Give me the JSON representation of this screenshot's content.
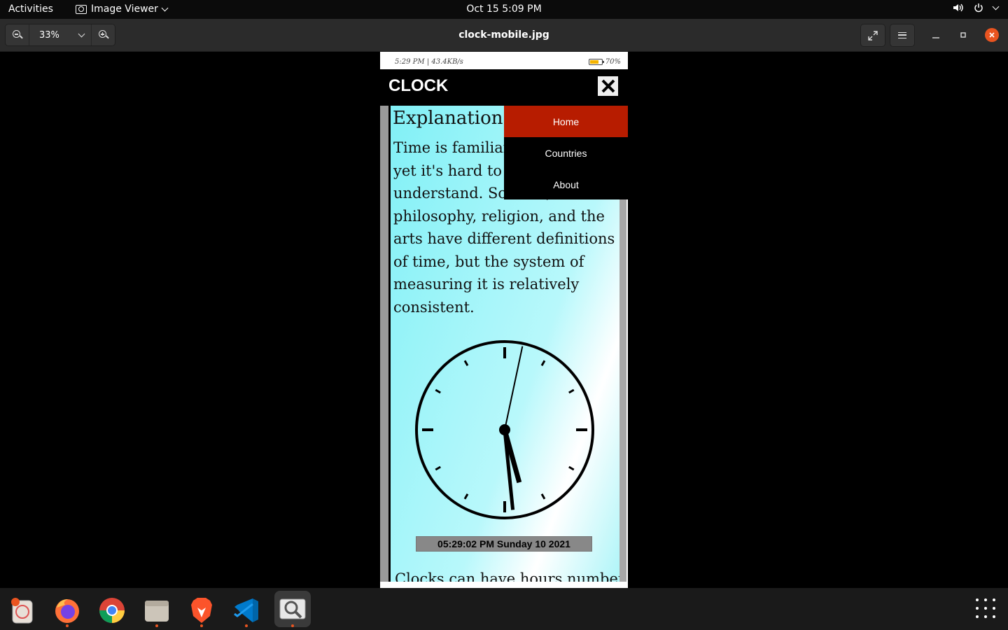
{
  "topbar": {
    "activities": "Activities",
    "app_name": "Image Viewer",
    "datetime": "Oct 15  5:09 PM"
  },
  "headerbar": {
    "zoom_level": "33%",
    "file_title": "clock-mobile.jpg"
  },
  "phone": {
    "status_left": "5:29 PM | 43.4KB/s",
    "status_right": "70%",
    "brand": "CLOCK",
    "menu": [
      {
        "label": "Home",
        "active": true
      },
      {
        "label": "Countries",
        "active": false
      },
      {
        "label": "About",
        "active": false
      }
    ],
    "heading": "Explanation of",
    "paragraph": "Time is familiar to everyone, yet it's hard to define and understand. Science, philosophy, religion, and the arts have different definitions of time, but the system of measuring it is relatively consistent.",
    "clock": {
      "hours": 5,
      "minutes": 29,
      "seconds": 2
    },
    "datetime_display": "05:29:02 PM Sunday 10 2021",
    "next_text": "Clocks can have hours numbered"
  },
  "dock": {
    "apps": [
      "ubuntu-software",
      "firefox",
      "chrome",
      "files",
      "brave",
      "vscode",
      "image-viewer"
    ]
  },
  "colors": {
    "accent": "#e95420",
    "menu_active": "#b71c00",
    "card_cyan": "#80f0f6"
  }
}
